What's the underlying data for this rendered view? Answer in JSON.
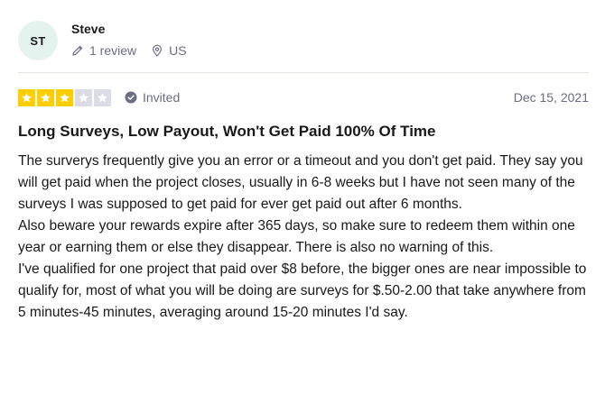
{
  "consumer": {
    "initials": "ST",
    "name": "Steve",
    "review_count": "1 review",
    "location": "US"
  },
  "review": {
    "rating": 3,
    "max_rating": 5,
    "verification": "Invited",
    "date": "Dec 15, 2021",
    "title": "Long Surveys, Low Payout, Won't Get Paid 100% Of Time",
    "paragraphs": [
      "The surverys frequently give you an error or a timeout and you don't get paid. They say you will get paid when the project closes, usually in 6-8 weeks but I have not seen many of the surveys I was supposed to get paid for ever get paid out after 6 months.",
      "Also beware your rewards expire after 365 days, so make sure to redeem them within one year or earning them or else they disappear. There is also no warning of this.",
      "I've qualified for one project that paid over $8 before, the bigger ones are near impossible to qualify for, most of what you will be doing are surveys for $.50-2.00 that take anywhere from 5 minutes-45 minutes, averaging around 15-20 minutes I'd say."
    ]
  },
  "icons": {
    "review_count": "pencil-icon",
    "location": "location-pin-icon",
    "verification": "check-circle-icon",
    "star": "star-icon"
  },
  "colors": {
    "star_filled": "#ffce00",
    "star_empty": "#dcdce6",
    "avatar_bg": "#e5f3ef",
    "muted_text": "#6c6c85",
    "text": "#191919"
  }
}
